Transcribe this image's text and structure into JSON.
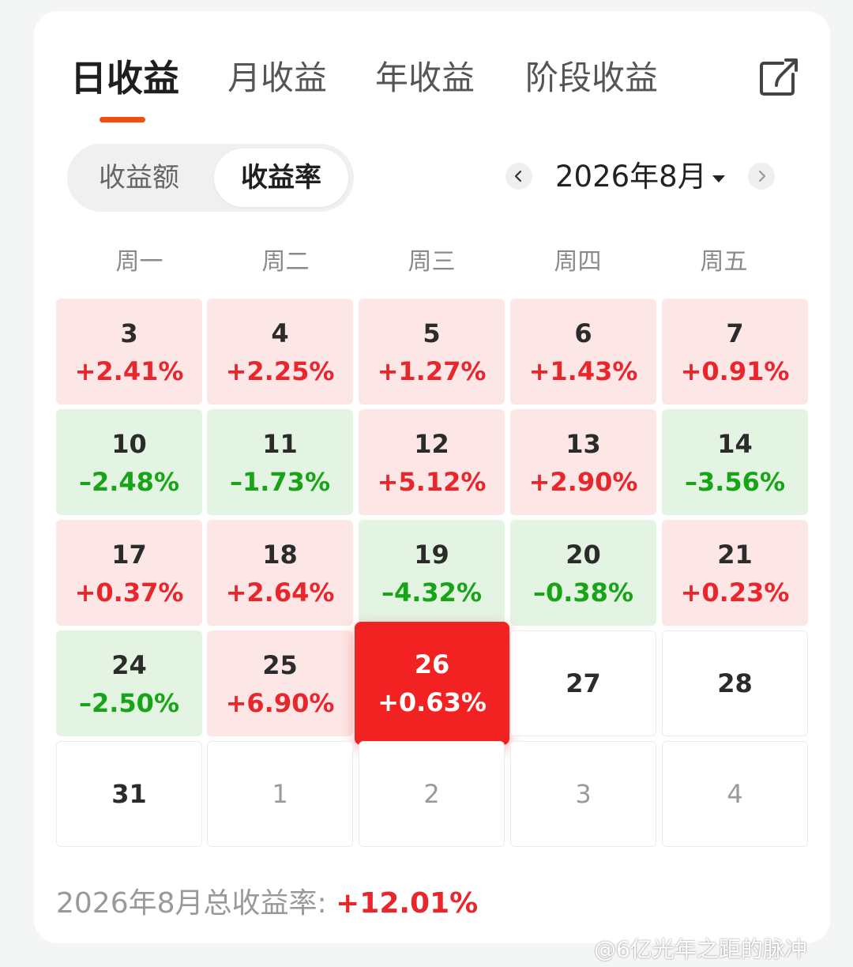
{
  "tabs": [
    {
      "label": "日收益",
      "active": true
    },
    {
      "label": "月收益",
      "active": false
    },
    {
      "label": "年收益",
      "active": false
    },
    {
      "label": "阶段收益",
      "active": false
    }
  ],
  "segment": {
    "options": [
      "收益额",
      "收益率"
    ],
    "selected": "收益率"
  },
  "month_nav": {
    "label": "2026年8月"
  },
  "weekdays": [
    "周一",
    "周二",
    "周三",
    "周四",
    "周五"
  ],
  "calendar": [
    [
      {
        "day": "3",
        "value": "+2.41%",
        "status": "up"
      },
      {
        "day": "4",
        "value": "+2.25%",
        "status": "up"
      },
      {
        "day": "5",
        "value": "+1.27%",
        "status": "up"
      },
      {
        "day": "6",
        "value": "+1.43%",
        "status": "up"
      },
      {
        "day": "7",
        "value": "+0.91%",
        "status": "up"
      }
    ],
    [
      {
        "day": "10",
        "value": "–2.48%",
        "status": "down"
      },
      {
        "day": "11",
        "value": "–1.73%",
        "status": "down"
      },
      {
        "day": "12",
        "value": "+5.12%",
        "status": "up"
      },
      {
        "day": "13",
        "value": "+2.90%",
        "status": "up"
      },
      {
        "day": "14",
        "value": "–3.56%",
        "status": "down"
      }
    ],
    [
      {
        "day": "17",
        "value": "+0.37%",
        "status": "up"
      },
      {
        "day": "18",
        "value": "+2.64%",
        "status": "up"
      },
      {
        "day": "19",
        "value": "–4.32%",
        "status": "down"
      },
      {
        "day": "20",
        "value": "–0.38%",
        "status": "down"
      },
      {
        "day": "21",
        "value": "+0.23%",
        "status": "up"
      }
    ],
    [
      {
        "day": "24",
        "value": "–2.50%",
        "status": "down"
      },
      {
        "day": "25",
        "value": "+6.90%",
        "status": "up"
      },
      {
        "day": "26",
        "value": "+0.63%",
        "status": "selected"
      },
      {
        "day": "27",
        "value": "",
        "status": "empty"
      },
      {
        "day": "28",
        "value": "",
        "status": "empty"
      }
    ],
    [
      {
        "day": "31",
        "value": "",
        "status": "empty"
      },
      {
        "day": "1",
        "value": "",
        "status": "other-month"
      },
      {
        "day": "2",
        "value": "",
        "status": "other-month"
      },
      {
        "day": "3",
        "value": "",
        "status": "other-month"
      },
      {
        "day": "4",
        "value": "",
        "status": "other-month"
      }
    ]
  ],
  "total": {
    "label": "2026年8月总收益率:",
    "value": "+12.01%"
  },
  "watermark": "@6亿光年之距的脉冲",
  "colors": {
    "up": "#e8262c",
    "down": "#17a417",
    "accent": "#f04e0c",
    "selected": "#f22222"
  },
  "icons": {
    "share": "share-icon",
    "prev": "chevron-left-icon",
    "next": "chevron-right-icon",
    "dropdown": "caret-down-icon"
  }
}
